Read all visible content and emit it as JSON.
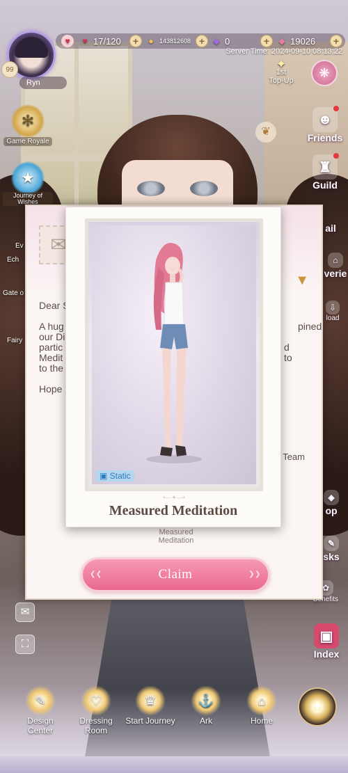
{
  "player": {
    "name": "Ryn",
    "level": "99"
  },
  "resources": {
    "stamina": "17/120",
    "gold": "143812608",
    "diamonds": "0",
    "gems": "19026"
  },
  "server_time": "Server Time: 2024-09-10 08:13:22",
  "left_menu": {
    "game_royale": "Game Royale",
    "journey_of_wishes": "Journey of Wishes",
    "ev": "Ev",
    "ech": "Ech",
    "gate": "Gate o",
    "fairy": "Fairy"
  },
  "top_up": {
    "line1": "1st",
    "line2": "Top-Up"
  },
  "right_menu": {
    "friends": "Friends",
    "guild": "Guild",
    "mail": "ail",
    "overie": "verie",
    "download": "load",
    "shop": "op",
    "tasks": "sks",
    "benefits": "Benefits",
    "index": "Index"
  },
  "mail": {
    "greeting": "Dear S",
    "body_lines": [
      "A hug",
      "our Di",
      "partic",
      "Medit",
      "to the ex"
    ],
    "body_right": [
      "pined",
      "",
      "d",
      "to"
    ],
    "hope": "Hope",
    "signature": "Team",
    "item_name": "Measured Meditation",
    "claim_label": "Claim"
  },
  "item_card": {
    "title": "Measured Meditation",
    "badge": "Static"
  },
  "bottom_nav": {
    "design_center": "Design Center",
    "dressing_room": "Dressing Room",
    "start_journey": "Start Journey",
    "ark": "Ark",
    "home": "Home"
  },
  "colors": {
    "claim_button": "#e9688e",
    "card_title": "#5c4a42",
    "badge_bg": "#b5d6ef"
  }
}
